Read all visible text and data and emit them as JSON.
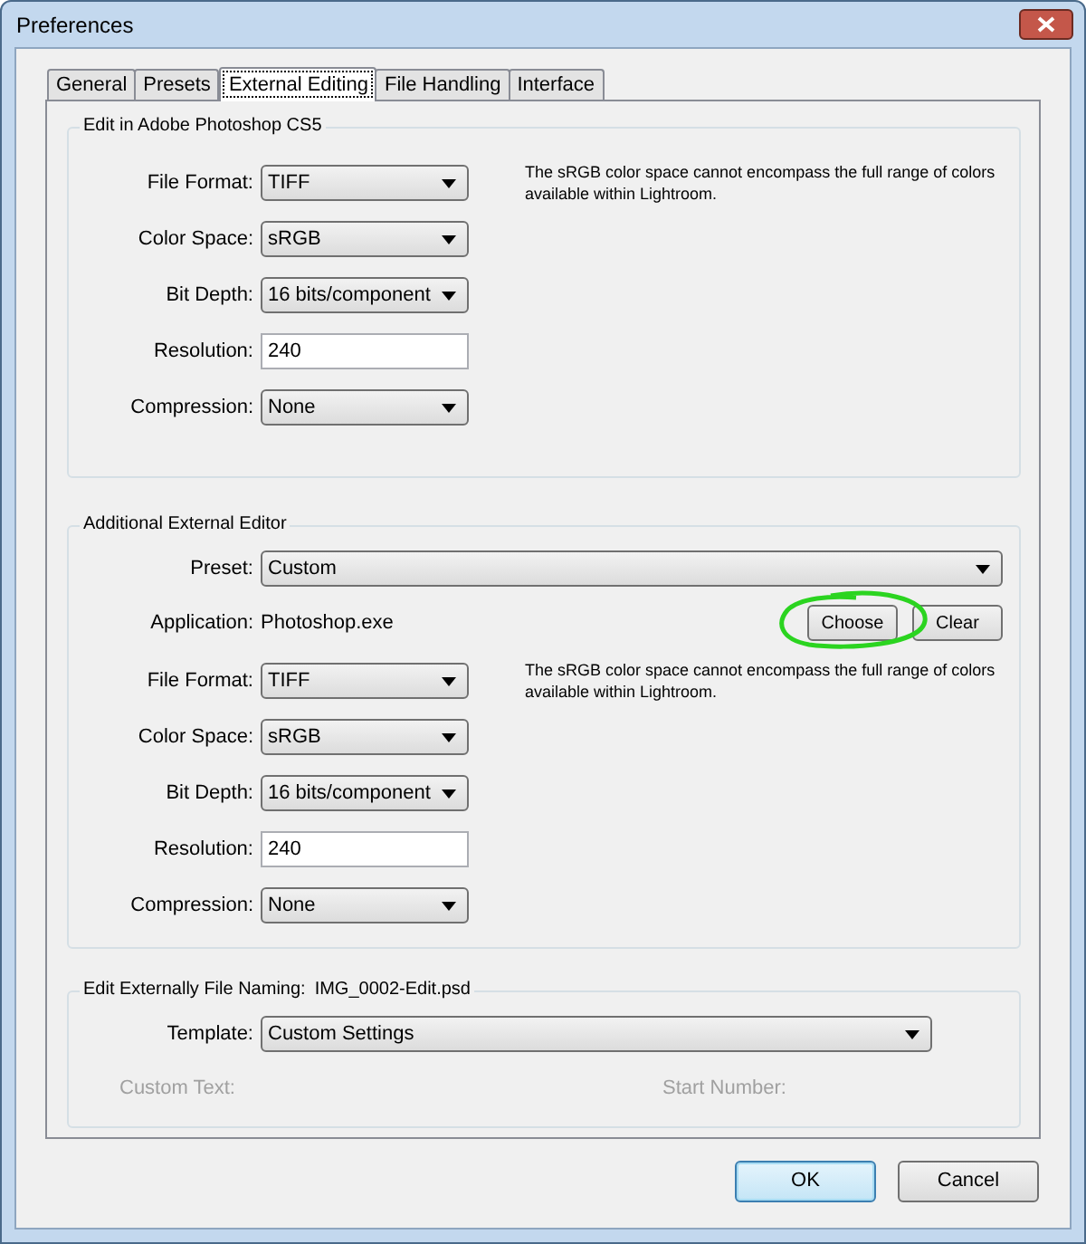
{
  "window": {
    "title": "Preferences"
  },
  "tabs": [
    {
      "label": "General",
      "selected": false
    },
    {
      "label": "Presets",
      "selected": false
    },
    {
      "label": "External Editing",
      "selected": true
    },
    {
      "label": "File Handling",
      "selected": false
    },
    {
      "label": "Interface",
      "selected": false
    }
  ],
  "groups": [
    {
      "title": "Edit in Adobe Photoshop CS5",
      "note": "The sRGB color space cannot encompass the full range of colors available within Lightroom.",
      "fields": [
        {
          "kind": "select",
          "label": "File Format:",
          "value": "TIFF"
        },
        {
          "kind": "select",
          "label": "Color Space:",
          "value": "sRGB"
        },
        {
          "kind": "select",
          "label": "Bit Depth:",
          "value": "16 bits/component"
        },
        {
          "kind": "input",
          "label": "Resolution:",
          "value": "240"
        },
        {
          "kind": "select",
          "label": "Compression:",
          "value": "None"
        }
      ]
    },
    {
      "title": "Additional External Editor",
      "preset": {
        "label": "Preset:",
        "value": "Custom"
      },
      "application": {
        "label": "Application:",
        "value": "Photoshop.exe",
        "buttons": [
          "Choose",
          "Clear"
        ]
      },
      "note": "The sRGB color space cannot encompass the full range of colors available within Lightroom.",
      "fields": [
        {
          "kind": "select",
          "label": "File Format:",
          "value": "TIFF"
        },
        {
          "kind": "select",
          "label": "Color Space:",
          "value": "sRGB"
        },
        {
          "kind": "select",
          "label": "Bit Depth:",
          "value": "16 bits/component"
        },
        {
          "kind": "input",
          "label": "Resolution:",
          "value": "240"
        },
        {
          "kind": "select",
          "label": "Compression:",
          "value": "None"
        }
      ]
    },
    {
      "title": "Edit Externally File Naming:",
      "example": "IMG_0002-Edit.psd",
      "template": {
        "label": "Template:",
        "value": "Custom Settings"
      },
      "extras": [
        {
          "label": "Custom Text:",
          "disabled": true
        },
        {
          "label": "Start Number:",
          "disabled": true
        }
      ]
    }
  ],
  "buttons": [
    {
      "label": "OK",
      "default": true
    },
    {
      "label": "Cancel",
      "default": false
    }
  ]
}
